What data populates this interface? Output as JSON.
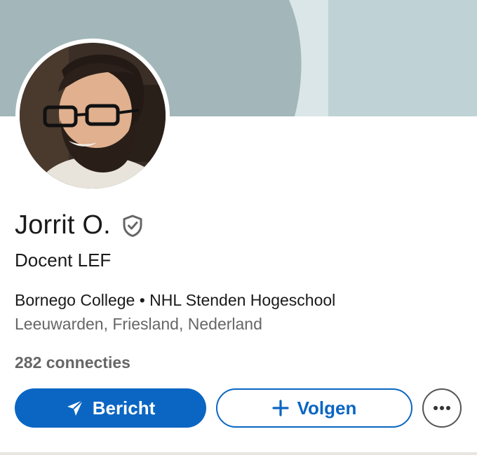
{
  "profile": {
    "name": "Jorrit O.",
    "headline": "Docent LEF",
    "organizations": "Bornego College • NHL Stenden Hogeschool",
    "location": "Leeuwarden, Friesland, Nederland",
    "connections": "282 connecties",
    "verified_icon": "shield-check-icon"
  },
  "actions": {
    "message_label": "Bericht",
    "message_icon": "send-icon",
    "follow_label": "Volgen",
    "follow_icon": "plus-icon",
    "more_icon": "more-icon"
  },
  "colors": {
    "primary": "#0a66c2",
    "text": "#1a1a1a",
    "secondary_text": "#666666",
    "cover_dark": "#a3b7ba",
    "cover_light": "#dbe6e8",
    "cover_right": "#bfd3d6"
  }
}
